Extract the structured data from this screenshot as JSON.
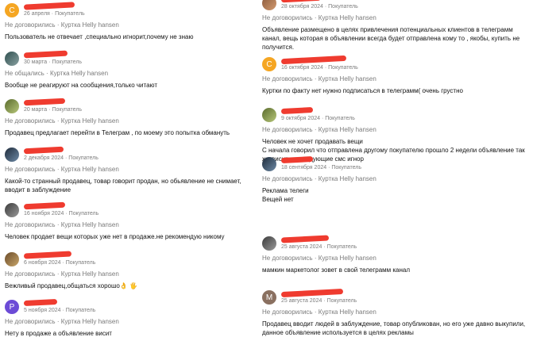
{
  "colors": {
    "redaction": "#ef3b2f",
    "meta_text": "#7c7c7c",
    "avatar_orange": "#f5a623",
    "avatar_purple": "#6c4bd6"
  },
  "left": [
    {
      "avatar": {
        "type": "letter",
        "letter": "С",
        "color": "#f5a623"
      },
      "date": "26 апреля",
      "role": "Покупатель",
      "status": "Не договорились",
      "item": "Куртка Helly hansen",
      "text": "Пользователь не отвечает ,специально игнорит,почему не знаю"
    },
    {
      "avatar": {
        "type": "photo",
        "icon": "person-photo-icon"
      },
      "date": "30 марта",
      "role": "Покупатель",
      "status": "Не общались",
      "item": "Куртка Helly hansen",
      "text": "Вообще не реагируют на сообщения,только читают"
    },
    {
      "avatar": {
        "type": "photo",
        "icon": "person-photo-icon"
      },
      "date": "20 марта",
      "role": "Покупатель",
      "status": "Не договорились",
      "item": "Куртка Helly hansen",
      "text": "Продавец предлагает перейти в Телеграм , по моему это попытка обмануть"
    },
    {
      "avatar": {
        "type": "photo",
        "icon": "photo-icon"
      },
      "date": "2 декабря 2024",
      "role": "Покупатель",
      "status": "Не договорились",
      "item": "Куртка Helly hansen",
      "text": "Какой-то странный продавец, товар говорит продан, но обьявление не снимает, вводит в заблуждение"
    },
    {
      "avatar": {
        "type": "photo",
        "icon": "landscape-photo-icon"
      },
      "date": "16 ноября 2024",
      "role": "Покупатель",
      "status": "Не договорились",
      "item": "Куртка Helly hansen",
      "text": "Человек продает вещи которых уже нет в продаже.не рекомендую никому"
    },
    {
      "avatar": {
        "type": "photo",
        "icon": "person-photo-icon"
      },
      "date": "6 ноября 2024",
      "role": "Покупатель",
      "status": "Не договорились",
      "item": "Куртка Helly hansen",
      "text": "Вежливый продавец,общаться хорошо👌 🖐"
    },
    {
      "avatar": {
        "type": "letter",
        "letter": "Р",
        "color": "#6c4bd6"
      },
      "date": "5 ноября 2024",
      "role": "Покупатель",
      "status": "Не договорились",
      "item": "Куртка Helly hansen",
      "text": "Нету в продаже а объявление висит"
    }
  ],
  "right": [
    {
      "avatar": {
        "type": "photo",
        "icon": "landscape-photo-icon"
      },
      "date": "28 октября 2024",
      "role": "Покупатель",
      "status": "Не договорились",
      "item": "Куртка Helly hansen",
      "text": "Объявление размещено в целях привлечения потенциальных клиентов в телеграмм канал, вещь которая в объявлении всегда будет отправлена кому то , якобы, купить не получится."
    },
    {
      "avatar": {
        "type": "letter",
        "letter": "С",
        "color": "#f5a623"
      },
      "date": "16 октября 2024",
      "role": "Покупатель",
      "status": "Не договорились",
      "item": "Куртка Helly hansen",
      "text": "Куртки по факту нет нужно подписаться в телеграмм( очень грустно"
    },
    {
      "avatar": {
        "type": "photo",
        "icon": "dark-photo-icon"
      },
      "date": "9 октября 2024",
      "role": "Покупатель",
      "status": "Не договорились",
      "item": "Куртка Helly hansen",
      "text": "Человек не хочет продавать вещи\nС начала говорил что отправлена другому покупателю прошло 2 недели объявление так же висит на следующие смс игнор"
    },
    {
      "avatar": {
        "type": "photo",
        "icon": "person-photo-icon"
      },
      "date": "18 сентября 2024",
      "role": "Покупатель",
      "status": "Не договорились",
      "item": "Куртка Helly hansen",
      "text": "Реклама телеги\nВещей нет"
    },
    {
      "avatar": {
        "type": "photo",
        "icon": "landscape-photo-icon"
      },
      "date": "25 августа 2024",
      "role": "Покупатель",
      "status": "Не договорились",
      "item": "Куртка Helly hansen",
      "text": "мамкин маркетолог зовет в свой телеграмм канал"
    },
    {
      "avatar": {
        "type": "letter",
        "letter": "М",
        "color": "#8a7060"
      },
      "date": "25 августа 2024",
      "role": "Покупатель",
      "status": "Не договорились",
      "item": "Куртка Helly hansen",
      "text": "Продавец вводит людей в заблуждение, товар опубликован, но его уже давно выкупили, данное объявление используется в целях рекламы"
    }
  ]
}
